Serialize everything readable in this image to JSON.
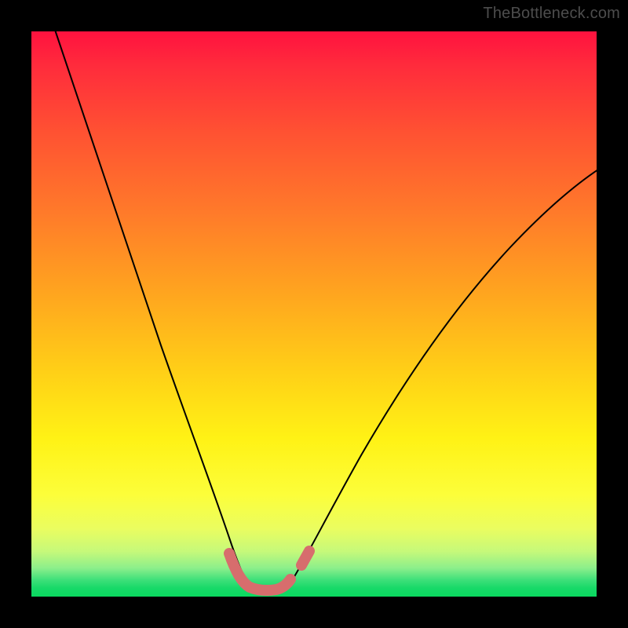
{
  "watermark": "TheBottleneck.com",
  "colors": {
    "background": "#000000",
    "gradient_top": "#ff123f",
    "gradient_mid": "#fff215",
    "gradient_bottom": "#0ad95f",
    "curve": "#000000",
    "marker": "#d76d6d"
  },
  "chart_data": {
    "type": "line",
    "title": "",
    "xlabel": "",
    "ylabel": "",
    "xlim": [
      0,
      100
    ],
    "ylim": [
      0,
      100
    ],
    "grid": false,
    "legend": false,
    "background": "heatmap-gradient (red→yellow→green, top→bottom)",
    "series": [
      {
        "name": "left-curve",
        "x": [
          4,
          8,
          12,
          16,
          20,
          24,
          28,
          31,
          33.5,
          35.5,
          37
        ],
        "y": [
          100,
          90,
          79,
          67,
          55,
          42,
          29,
          17,
          9,
          4,
          1
        ]
      },
      {
        "name": "right-curve",
        "x": [
          44,
          47,
          51,
          57,
          64,
          72,
          80,
          88,
          96,
          100
        ],
        "y": [
          1,
          6,
          14,
          25,
          37,
          49,
          59,
          67,
          73,
          76
        ]
      },
      {
        "name": "valley-flat",
        "x": [
          37,
          39,
          41,
          43,
          44
        ],
        "y": [
          1,
          0.5,
          0.4,
          0.5,
          1
        ]
      }
    ],
    "markers": [
      {
        "name": "valley-highlight",
        "shape": "thick-band",
        "color": "#d76d6d",
        "x": [
          34,
          36,
          38,
          40,
          42,
          43.5
        ],
        "y": [
          7,
          3,
          1.2,
          1,
          1.2,
          3
        ]
      },
      {
        "name": "right-shoulder-dot",
        "shape": "short-segment",
        "color": "#d76d6d",
        "x": [
          46,
          47.5
        ],
        "y": [
          6,
          9
        ]
      }
    ]
  }
}
